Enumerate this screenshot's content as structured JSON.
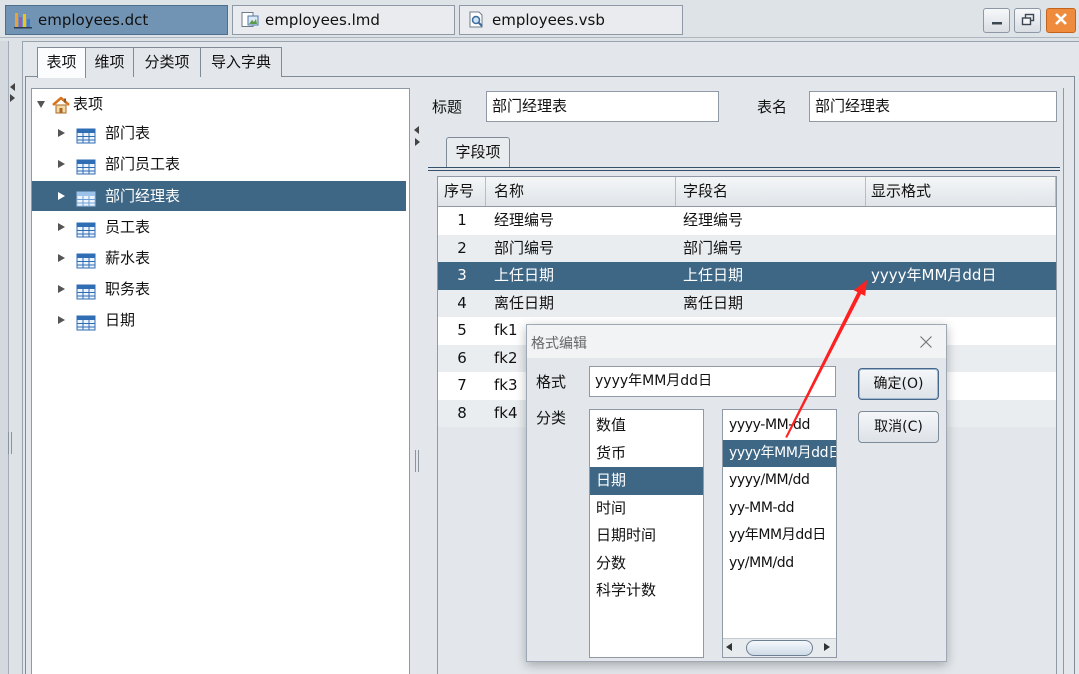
{
  "doc_tabs": [
    {
      "label": "employees.dct",
      "icon": "bar-chart-icon",
      "active": true
    },
    {
      "label": "employees.lmd",
      "icon": "image-file-icon",
      "active": false
    },
    {
      "label": "employees.vsb",
      "icon": "file-search-icon",
      "active": false
    }
  ],
  "window_controls": [
    "minimize-icon",
    "restore-icon",
    "close-icon"
  ],
  "section_tabs": [
    {
      "label": "表项",
      "active": true
    },
    {
      "label": "维项",
      "active": false
    },
    {
      "label": "分类项",
      "active": false
    },
    {
      "label": "导入字典",
      "active": false
    }
  ],
  "tree": {
    "root": {
      "label": "表项",
      "icon": "home-icon",
      "expanded": true
    },
    "item_icon": "table-icon",
    "items": [
      {
        "label": "部门表",
        "selected": false
      },
      {
        "label": "部门员工表",
        "selected": false
      },
      {
        "label": "部门经理表",
        "selected": true
      },
      {
        "label": "员工表",
        "selected": false
      },
      {
        "label": "薪水表",
        "selected": false
      },
      {
        "label": "职务表",
        "selected": false
      },
      {
        "label": "日期",
        "selected": false
      }
    ]
  },
  "form": {
    "title_label": "标题",
    "title_value": "部门经理表",
    "table_name_label": "表名",
    "table_name_value": "部门经理表"
  },
  "field_tab": {
    "label": "字段项"
  },
  "grid": {
    "columns": [
      "序号",
      "名称",
      "字段名",
      "显示格式"
    ],
    "rows": [
      {
        "no": "1",
        "name": "经理编号",
        "field": "经理编号",
        "format": "",
        "selected": false
      },
      {
        "no": "2",
        "name": "部门编号",
        "field": "部门编号",
        "format": "",
        "selected": false
      },
      {
        "no": "3",
        "name": "上任日期",
        "field": "上任日期",
        "format": "yyyy年MM月dd日",
        "selected": true
      },
      {
        "no": "4",
        "name": "离任日期",
        "field": "离任日期",
        "format": "",
        "selected": false
      },
      {
        "no": "5",
        "name": "fk1",
        "selected": false
      },
      {
        "no": "6",
        "name": "fk2",
        "selected": false
      },
      {
        "no": "7",
        "name": "fk3",
        "selected": false
      },
      {
        "no": "8",
        "name": "fk4",
        "selected": false
      }
    ]
  },
  "dialog": {
    "title": "格式编辑",
    "format_label": "格式",
    "format_value": "yyyy年MM月dd日",
    "ok_label": "确定(O)",
    "cancel_label": "取消(C)",
    "category_label": "分类",
    "categories": [
      {
        "label": "数值",
        "selected": false
      },
      {
        "label": "货币",
        "selected": false
      },
      {
        "label": "日期",
        "selected": true
      },
      {
        "label": "时间",
        "selected": false
      },
      {
        "label": "日期时间",
        "selected": false
      },
      {
        "label": "分数",
        "selected": false
      },
      {
        "label": "科学计数",
        "selected": false
      }
    ],
    "formats": [
      {
        "label": "yyyy-MM-dd",
        "selected": false
      },
      {
        "label": "yyyy年MM月dd日",
        "selected": true
      },
      {
        "label": "yyyy/MM/dd",
        "selected": false
      },
      {
        "label": "yy-MM-dd",
        "selected": false
      },
      {
        "label": "yy年MM月dd日",
        "selected": false
      },
      {
        "label": "yy/MM/dd",
        "selected": false
      }
    ]
  },
  "colors": {
    "selection": "#3e6685",
    "annotation_arrow": "#ff2020",
    "close_button": "#ef8b3d"
  }
}
